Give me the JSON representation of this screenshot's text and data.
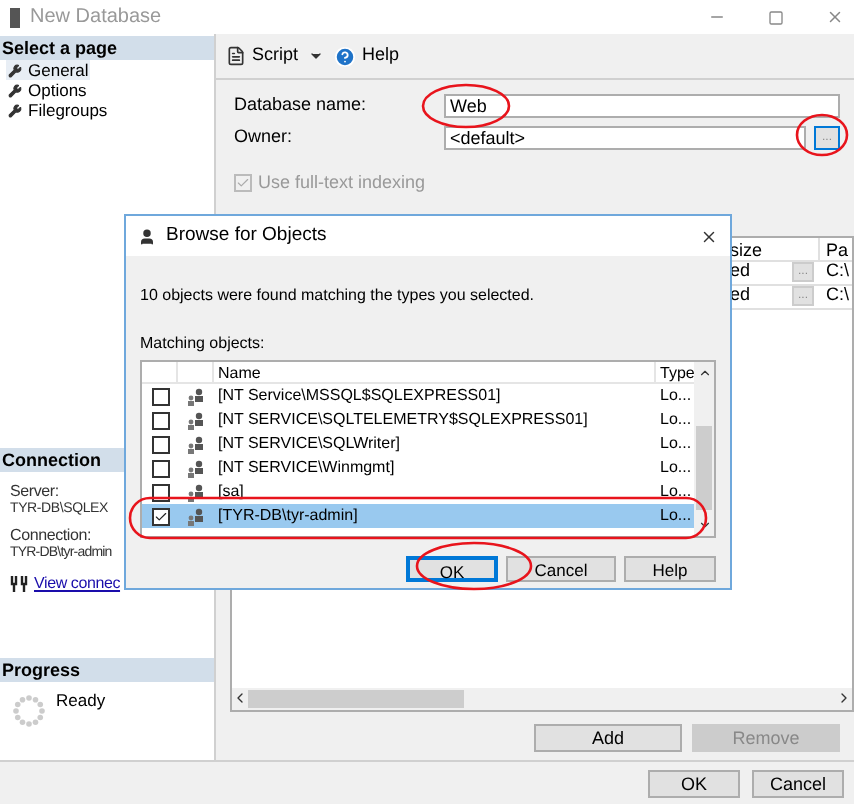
{
  "window": {
    "title": "New Database"
  },
  "sidebar": {
    "header": "Select a page",
    "pages": [
      {
        "label": "General",
        "selected": true
      },
      {
        "label": "Options",
        "selected": false
      },
      {
        "label": "Filegroups",
        "selected": false
      }
    ]
  },
  "connection": {
    "header": "Connection",
    "server_label": "Server:",
    "server": "TYR-DB\\SQLEX",
    "connection_label": "Connection:",
    "connection": "TYR-DB\\tyr-admin",
    "link": "View connec"
  },
  "progress": {
    "header": "Progress",
    "status": "Ready"
  },
  "toolbar": {
    "script": "Script",
    "help": "Help"
  },
  "form": {
    "name_label": "Database name:",
    "name_value": "Web",
    "owner_label": "Owner:",
    "owner_value": "<default>",
    "browse": "...",
    "fulltext": {
      "label": "Use full-text indexing",
      "checked": true,
      "disabled": true
    }
  },
  "files_grid": {
    "columns": [
      "size",
      "",
      "Pa"
    ],
    "rows": [
      [
        "ed",
        "...",
        "C:\\"
      ],
      [
        "ed",
        "...",
        "C:\\"
      ]
    ]
  },
  "files_buttons": [
    {
      "label": "Add",
      "disabled": false
    },
    {
      "label": "Remove",
      "disabled": true
    }
  ],
  "dialog": {
    "title": "Browse for Objects",
    "message": "10 objects were found matching the types you selected.",
    "list_label": "Matching objects:",
    "columns": [
      "Name",
      "Type"
    ],
    "rows": [
      {
        "name": "[NT Service\\MSSQL$SQLEXPRESS01]",
        "type": "Lo...",
        "checked": false,
        "selected": false
      },
      {
        "name": "[NT SERVICE\\SQLTELEMETRY$SQLEXPRESS01]",
        "type": "Lo...",
        "checked": false,
        "selected": false
      },
      {
        "name": "[NT SERVICE\\SQLWriter]",
        "type": "Lo...",
        "checked": false,
        "selected": false
      },
      {
        "name": "[NT SERVICE\\Winmgmt]",
        "type": "Lo...",
        "checked": false,
        "selected": false
      },
      {
        "name": "[sa]",
        "type": "Lo...",
        "checked": false,
        "selected": false
      },
      {
        "name": "[TYR-DB\\tyr-admin]",
        "type": "Lo...",
        "checked": true,
        "selected": true
      }
    ],
    "buttons": [
      {
        "label": "OK",
        "default": true
      },
      {
        "label": "Cancel",
        "default": false
      },
      {
        "label": "Help",
        "default": false
      }
    ]
  },
  "buttons": [
    "OK",
    "Cancel"
  ]
}
